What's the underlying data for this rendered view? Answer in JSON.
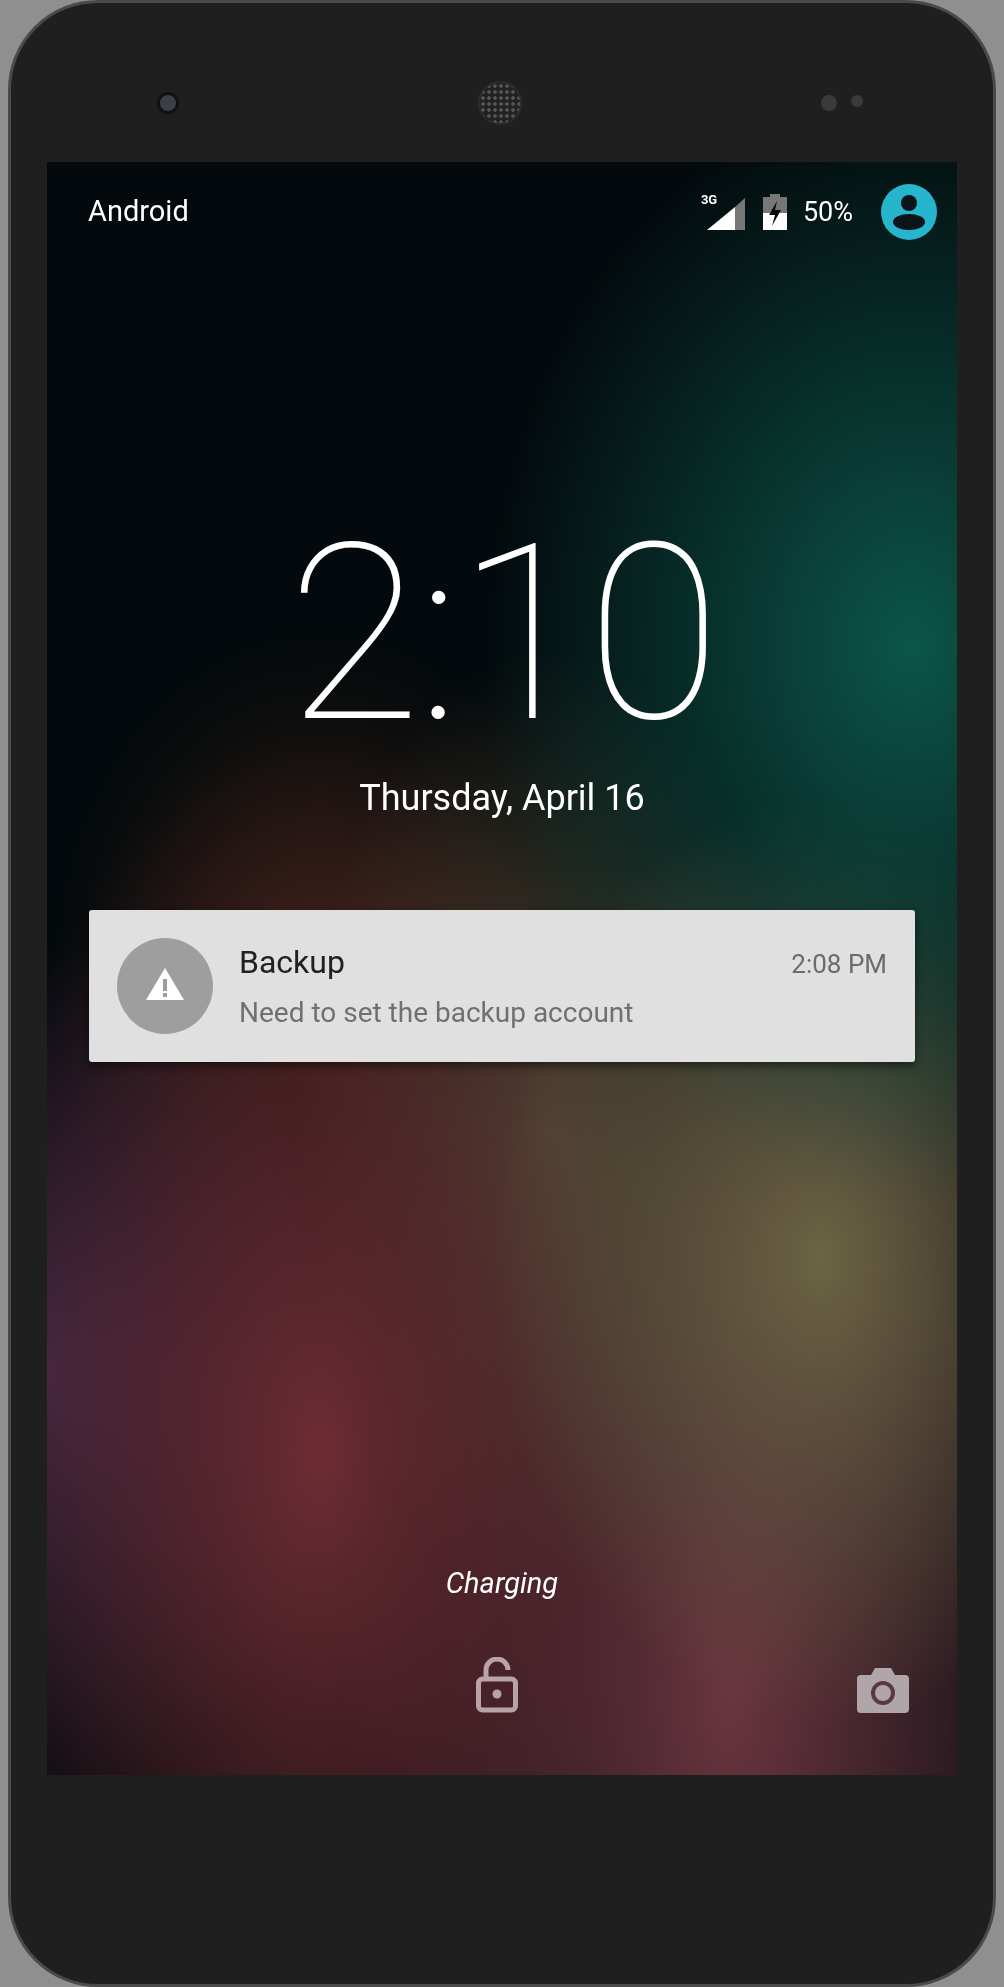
{
  "status_bar": {
    "carrier": "Android",
    "network": "3G",
    "battery": "50%"
  },
  "clock": {
    "time": "2:10",
    "date": "Thursday, April 16"
  },
  "notifications": [
    {
      "title": "Backup",
      "text": "Need to set the backup account",
      "time": "2:08 PM"
    }
  ],
  "charging": "Charging"
}
